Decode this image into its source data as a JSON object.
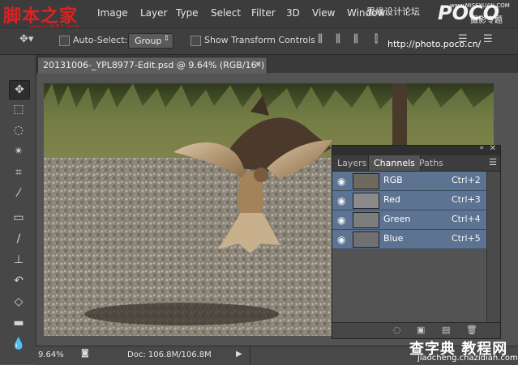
{
  "watermarks": {
    "top_left": "脚本之家",
    "top_left_url": "www.jb51.net",
    "top_right_cn": "思缘设计论坛",
    "top_right_site": "www.MISSYUAN.COM",
    "top_right_poco": "POCO",
    "top_right_poco_cn": "摄影专题",
    "poco_url": "http://photo.poco.cn/",
    "bottom_right_cn": "查字典 教程网",
    "bottom_right_url": "jiaocheng.chazidian.com"
  },
  "menubar": {
    "items": [
      "Image",
      "Layer",
      "Type",
      "Select",
      "Filter",
      "3D",
      "View",
      "Window"
    ]
  },
  "options": {
    "auto_select_label": "Auto-Select:",
    "group_value": "Group",
    "show_transform_label": "Show Transform Controls"
  },
  "document": {
    "tab_title": "20131006-_YPL8977-Edit.psd @ 9.64% (RGB/16*)",
    "close": "×"
  },
  "statusbar": {
    "zoom": "9.64%",
    "doc_info": "Doc: 106.8M/106.8M"
  },
  "panel": {
    "tabs": [
      "Layers",
      "Channels",
      "Paths"
    ],
    "active_tab": "Channels",
    "channels": [
      {
        "name": "RGB",
        "shortcut": "Ctrl+2"
      },
      {
        "name": "Red",
        "shortcut": "Ctrl+3"
      },
      {
        "name": "Green",
        "shortcut": "Ctrl+4"
      },
      {
        "name": "Blue",
        "shortcut": "Ctrl+5"
      }
    ]
  },
  "colors": {
    "selection": "#5d7392",
    "menubar": "#3c3c3c",
    "workspace": "#535353"
  }
}
